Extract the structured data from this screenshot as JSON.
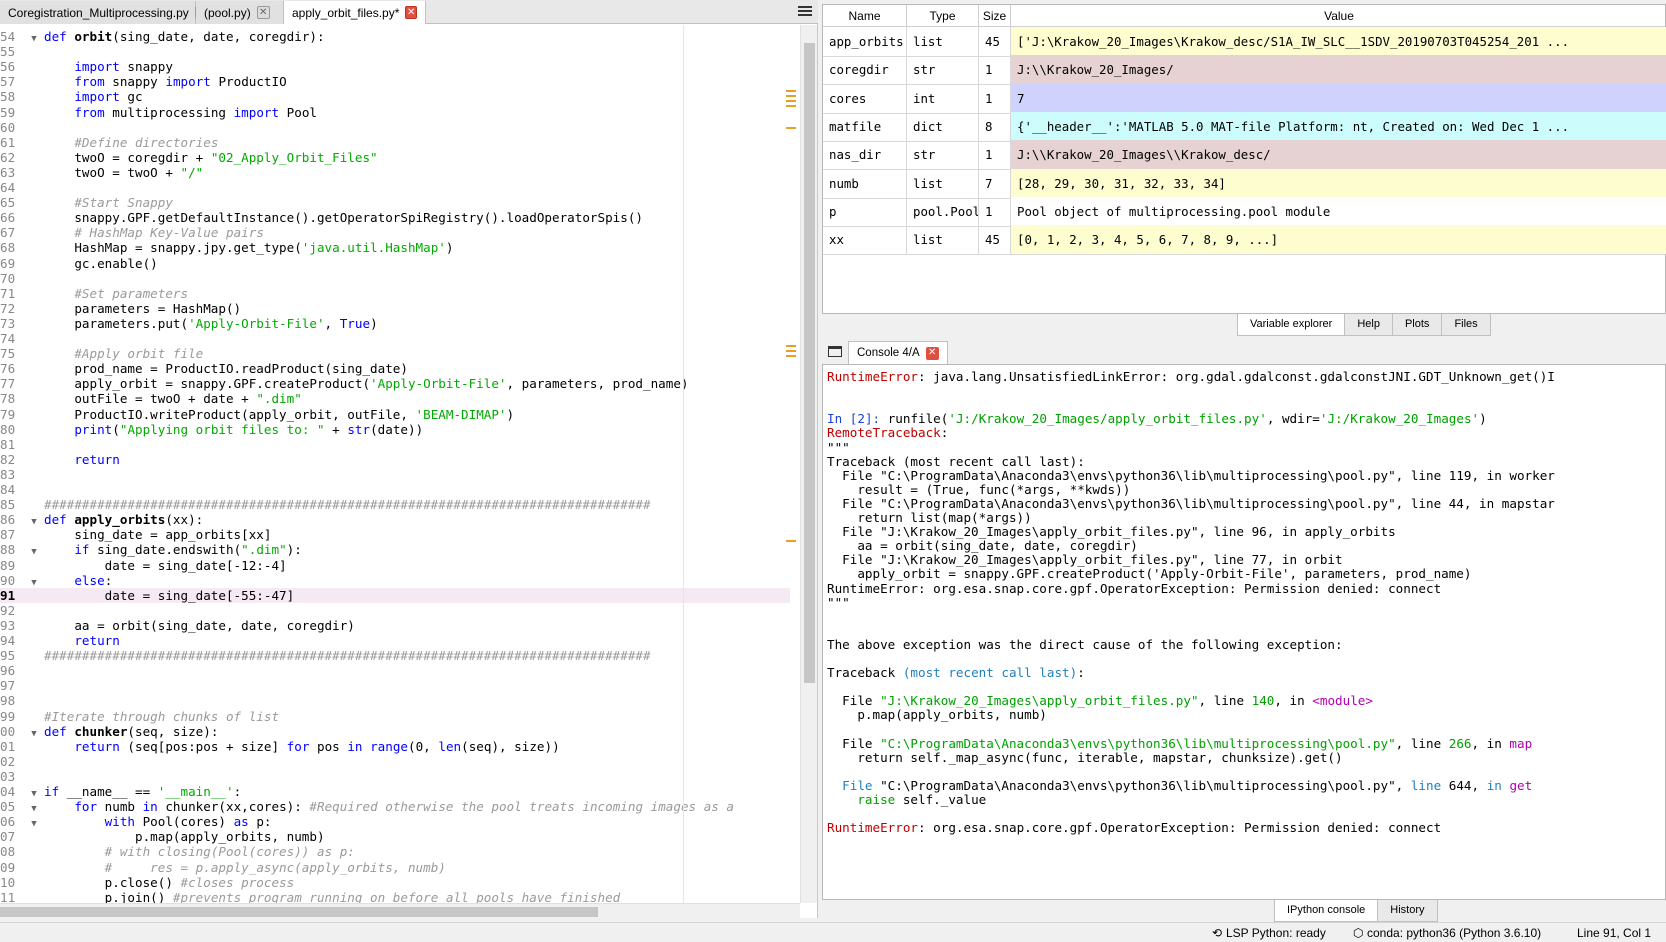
{
  "editor": {
    "tabs": [
      {
        "label": "Coregistration_Multiprocessing.py",
        "active": false
      },
      {
        "label": "(pool.py)",
        "active": false
      },
      {
        "label": "apply_orbit_files.py*",
        "active": true
      }
    ],
    "current_line": 91,
    "lines": [
      {
        "n": "54",
        "fold": true,
        "html": "<span class='t-kw'>def</span> <span class='t-def'>orbit</span>(sing_date, date, coregdir):"
      },
      {
        "n": "55",
        "html": ""
      },
      {
        "n": "56",
        "html": "    <span class='t-kw'>import</span> snappy"
      },
      {
        "n": "57",
        "html": "    <span class='t-kw'>from</span> snappy <span class='t-kw'>import</span> ProductIO"
      },
      {
        "n": "58",
        "html": "    <span class='t-kw'>import</span> gc"
      },
      {
        "n": "59",
        "html": "    <span class='t-kw'>from</span> multiprocessing <span class='t-kw'>import</span> Pool"
      },
      {
        "n": "60",
        "html": ""
      },
      {
        "n": "61",
        "html": "    <span class='t-com'>#Define directories</span>"
      },
      {
        "n": "62",
        "html": "    twoO = coregdir + <span class='t-str'>\"02_Apply_Orbit_Files\"</span>"
      },
      {
        "n": "63",
        "html": "    twoO = twoO + <span class='t-str'>\"/\"</span>"
      },
      {
        "n": "64",
        "html": ""
      },
      {
        "n": "65",
        "html": "    <span class='t-com'>#Start Snappy</span>"
      },
      {
        "n": "66",
        "html": "    snappy.GPF.getDefaultInstance().getOperatorSpiRegistry().loadOperatorSpis()"
      },
      {
        "n": "67",
        "html": "    <span class='t-com'># HashMap Key-Value pairs</span>"
      },
      {
        "n": "68",
        "html": "    HashMap = snappy.jpy.get_type(<span class='t-str'>'java.util.HashMap'</span>)"
      },
      {
        "n": "69",
        "html": "    gc.enable()"
      },
      {
        "n": "70",
        "html": ""
      },
      {
        "n": "71",
        "html": "    <span class='t-com'>#Set parameters</span>"
      },
      {
        "n": "72",
        "html": "    parameters = HashMap()"
      },
      {
        "n": "73",
        "html": "    parameters.put(<span class='t-str'>'Apply-Orbit-File'</span>, <span class='t-true'>True</span>)"
      },
      {
        "n": "74",
        "html": ""
      },
      {
        "n": "75",
        "html": "    <span class='t-com'>#Apply orbit file</span>"
      },
      {
        "n": "76",
        "html": "    prod_name = ProductIO.readProduct(sing_date)"
      },
      {
        "n": "77",
        "html": "    apply_orbit = snappy.GPF.createProduct(<span class='t-str'>'Apply-Orbit-File'</span>, parameters, prod_name)"
      },
      {
        "n": "78",
        "html": "    outFile = twoO + date + <span class='t-str'>\".dim\"</span>"
      },
      {
        "n": "79",
        "html": "    ProductIO.writeProduct(apply_orbit, outFile, <span class='t-str'>'BEAM-DIMAP'</span>)"
      },
      {
        "n": "80",
        "html": "    <span class='t-kw'>print</span>(<span class='t-str'>\"Applying orbit files to: \"</span> + <span class='t-kw'>str</span>(date))"
      },
      {
        "n": "81",
        "html": ""
      },
      {
        "n": "82",
        "html": "    <span class='t-kw'>return</span>"
      },
      {
        "n": "83",
        "html": ""
      },
      {
        "n": "84",
        "html": ""
      },
      {
        "n": "85",
        "html": "<span class='t-com'>################################################################################</span>"
      },
      {
        "n": "86",
        "fold": true,
        "html": "<span class='t-kw'>def</span> <span class='t-def'>apply_orbits</span>(xx):"
      },
      {
        "n": "87",
        "html": "    sing_date = app_orbits[xx]"
      },
      {
        "n": "88",
        "fold": true,
        "html": "    <span class='t-kw'>if</span> sing_date.endswith(<span class='t-str'>\".dim\"</span>):"
      },
      {
        "n": "89",
        "html": "        date = sing_date[-12:-4]"
      },
      {
        "n": "90",
        "fold": true,
        "html": "    <span class='t-kw'>else</span>:"
      },
      {
        "n": "91",
        "html": "        date = sing_date[-55:-47]"
      },
      {
        "n": "92",
        "html": ""
      },
      {
        "n": "93",
        "html": "    aa = orbit(sing_date, date, coregdir)"
      },
      {
        "n": "94",
        "html": "    <span class='t-kw'>return</span>"
      },
      {
        "n": "95",
        "html": "<span class='t-com'>################################################################################</span>"
      },
      {
        "n": "96",
        "html": ""
      },
      {
        "n": "97",
        "html": ""
      },
      {
        "n": "98",
        "html": ""
      },
      {
        "n": "99",
        "html": "<span class='t-com'>#Iterate through chunks of list</span>"
      },
      {
        "n": "00",
        "fold": true,
        "html": "<span class='t-kw'>def</span> <span class='t-def'>chunker</span>(seq, size):"
      },
      {
        "n": "01",
        "html": "    <span class='t-kw'>return</span> (seq[pos:pos + size] <span class='t-kw'>for</span> pos <span class='t-kw'>in</span> <span class='t-kw'>range</span>(0, <span class='t-kw'>len</span>(seq), size))"
      },
      {
        "n": "02",
        "html": ""
      },
      {
        "n": "03",
        "html": ""
      },
      {
        "n": "04",
        "fold": true,
        "html": "<span class='t-kw'>if</span> __name__ == <span class='t-str'>'__main__'</span>:"
      },
      {
        "n": "05",
        "fold": true,
        "html": "    <span class='t-kw'>for</span> numb <span class='t-kw'>in</span> chunker(xx,cores): <span class='t-com'>#Required otherwise the pool treats incoming images as a</span>"
      },
      {
        "n": "06",
        "fold": true,
        "html": "        <span class='t-kw'>with</span> Pool(cores) <span class='t-kw'>as</span> p:"
      },
      {
        "n": "07",
        "html": "            p.map(apply_orbits, numb)"
      },
      {
        "n": "08",
        "html": "        <span class='t-com'># with closing(Pool(cores)) as p:</span>"
      },
      {
        "n": "09",
        "html": "        <span class='t-com'>#     res = p.apply_async(apply_orbits, numb)</span>"
      },
      {
        "n": "10",
        "html": "        p.close() <span class='t-com'>#closes process</span>"
      },
      {
        "n": "11",
        "html": "        p.join() <span class='t-com'>#prevents program running on before all pools have finished</span>"
      },
      {
        "n": "12",
        "html": ""
      }
    ]
  },
  "variable_explorer": {
    "columns": [
      "Name",
      "Type",
      "Size",
      "Value"
    ],
    "rows": [
      {
        "name": "app_orbits",
        "type": "list",
        "size": "45",
        "value": "['J:\\Krakow_20_Images\\Krakow_desc/S1A_IW_SLC__1SDV_20190703T045254_201 ...",
        "color": "#fdfdd0"
      },
      {
        "name": "coregdir",
        "type": "str",
        "size": "1",
        "value": "J:\\\\Krakow_20_Images/",
        "color": "#e6d2d2"
      },
      {
        "name": "cores",
        "type": "int",
        "size": "1",
        "value": "7",
        "color": "#cfd2fc"
      },
      {
        "name": "matfile",
        "type": "dict",
        "size": "8",
        "value": "{'__header__':'MATLAB 5.0 MAT-file Platform: nt, Created on: Wed Dec 1 ...",
        "color": "#ccfcfc"
      },
      {
        "name": "nas_dir",
        "type": "str",
        "size": "1",
        "value": "J:\\\\Krakow_20_Images\\\\Krakow_desc/",
        "color": "#e6d2d2"
      },
      {
        "name": "numb",
        "type": "list",
        "size": "7",
        "value": "[28, 29, 30, 31, 32, 33, 34]",
        "color": "#fdfdd0"
      },
      {
        "name": "p",
        "type": "pool.Pool",
        "size": "1",
        "value": "Pool object of multiprocessing.pool module",
        "color": "#ffffff"
      },
      {
        "name": "xx",
        "type": "list",
        "size": "45",
        "value": "[0, 1, 2, 3, 4, 5, 6, 7, 8, 9, ...]",
        "color": "#fdfdd0"
      }
    ],
    "tabs": [
      "Variable explorer",
      "Help",
      "Plots",
      "Files"
    ]
  },
  "console": {
    "tab_label": "Console 4/A",
    "tabs": [
      "IPython console",
      "History"
    ],
    "lines": [
      {
        "y": 0,
        "html": "<span class='c-red'>RuntimeError</span>: java.lang.UnsatisfiedLinkError: org.gdal.gdalconst.gdalconstJNI.GDT_Unknown_get()I"
      },
      {
        "y": 2,
        "html": ""
      },
      {
        "y": 3,
        "html": "<span class='c-blue'>In [</span><span class='c-blue'>2</span><span class='c-blue'>]:</span> runfile(<span class='c-grn'>'J:/Krakow_20_Images/apply_orbit_files.py'</span>, wdir=<span class='c-grn'>'J:/Krakow_20_Images'</span>)"
      },
      {
        "y": 4,
        "html": "<span class='c-red'>RemoteTraceback</span>:"
      },
      {
        "y": 5,
        "html": "\"\"\""
      },
      {
        "y": 6,
        "html": "Traceback (most recent call last):"
      },
      {
        "y": 7,
        "html": "  File \"C:\\ProgramData\\Anaconda3\\envs\\python36\\lib\\multiprocessing\\pool.py\", line 119, in worker"
      },
      {
        "y": 8,
        "html": "    result = (True, func(*args, **kwds))"
      },
      {
        "y": 9,
        "html": "  File \"C:\\ProgramData\\Anaconda3\\envs\\python36\\lib\\multiprocessing\\pool.py\", line 44, in mapstar"
      },
      {
        "y": 10,
        "html": "    return list(map(*args))"
      },
      {
        "y": 11,
        "html": "  File \"J:\\Krakow_20_Images\\apply_orbit_files.py\", line 96, in apply_orbits"
      },
      {
        "y": 12,
        "html": "    aa = orbit(sing_date, date, coregdir)"
      },
      {
        "y": 13,
        "html": "  File \"J:\\Krakow_20_Images\\apply_orbit_files.py\", line 77, in orbit"
      },
      {
        "y": 14,
        "html": "    apply_orbit = snappy.GPF.createProduct('Apply-Orbit-File', parameters, prod_name)"
      },
      {
        "y": 15,
        "html": "RuntimeError: org.esa.snap.core.gpf.OperatorException: Permission denied: connect"
      },
      {
        "y": 16,
        "html": "\"\"\""
      },
      {
        "y": 19,
        "html": "The above exception was the direct cause of the following exception:"
      },
      {
        "y": 21,
        "html": "Traceback <span class='c-cyn'>(most recent call last)</span>:"
      },
      {
        "y": 23,
        "html": "  File <span class='c-grn'>\"J:\\Krakow_20_Images\\apply_orbit_files.py\"</span>, line <span class='c-grn'>140</span>, in <span class='c-mag'>&lt;module&gt;</span>"
      },
      {
        "y": 24,
        "html": "    p.map(apply_orbits, numb)"
      },
      {
        "y": 26,
        "html": "  File <span class='c-grn'>\"C:\\ProgramData\\Anaconda3\\envs\\python36\\lib\\multiprocessing\\pool.py\"</span>, line <span class='c-grn'>266</span>, in <span class='c-mag'>map</span>"
      },
      {
        "y": 27,
        "html": "    return self._map_async(func, iterable, mapstar, chunksize).get()"
      },
      {
        "y": 29,
        "html": "  <span class='c-cyn'>File</span> \"C:\\ProgramData\\Anaconda3\\envs\\python36\\lib\\multiprocessing\\pool.py\", <span class='c-cyn'>line</span> 644, <span class='c-cyn'>in</span> <span class='c-mag'>get</span>"
      },
      {
        "y": 30,
        "html": "    <span class='c-grn'>raise</span> self._value"
      },
      {
        "y": 32,
        "html": "<span class='c-red'>RuntimeError</span>: org.esa.snap.core.gpf.OperatorException: Permission denied: connect"
      }
    ]
  },
  "statusbar": {
    "lsp": "LSP Python: ready",
    "conda": "conda: python36 (Python 3.6.10)",
    "position": "Line 91, Col 1"
  }
}
